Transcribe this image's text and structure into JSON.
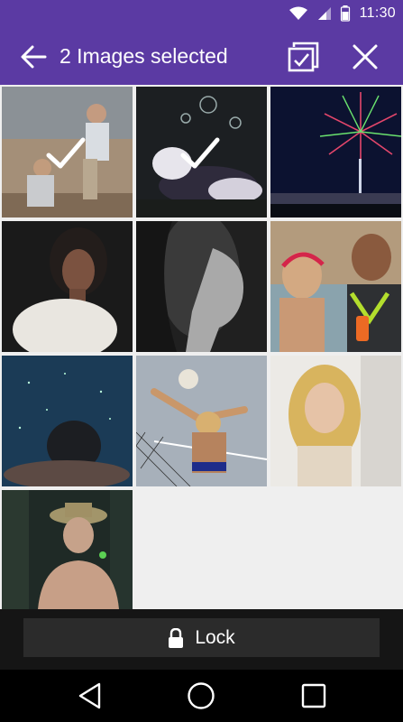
{
  "status_bar": {
    "time": "11:30",
    "icons": [
      "wifi-icon",
      "cell-signal-icon",
      "battery-icon"
    ]
  },
  "app_bar": {
    "title": "2 Images selected",
    "back_icon": "arrow-back-icon",
    "select_all_icon": "select-all-icon",
    "close_icon": "close-icon",
    "color": "#5b3aa3"
  },
  "gallery": {
    "images": [
      {
        "subject": "man playing with child on beach",
        "selected": true
      },
      {
        "subject": "dog jumping at bubbles",
        "selected": true
      },
      {
        "subject": "fireworks over city at night",
        "selected": false
      },
      {
        "subject": "woman in white sweater",
        "selected": false
      },
      {
        "subject": "woman profile black and white",
        "selected": false
      },
      {
        "subject": "couple laughing outdoors",
        "selected": false
      },
      {
        "subject": "person swimming underwater",
        "selected": false
      },
      {
        "subject": "beach volleyball player",
        "selected": false
      },
      {
        "subject": "blonde woman smiling",
        "selected": false
      },
      {
        "subject": "man in hat blowing bubbles",
        "selected": false
      }
    ]
  },
  "lock_button": {
    "label": "Lock",
    "icon": "lock-icon"
  },
  "nav_bar": {
    "icons": [
      "nav-back-icon",
      "nav-home-icon",
      "nav-recents-icon"
    ]
  }
}
